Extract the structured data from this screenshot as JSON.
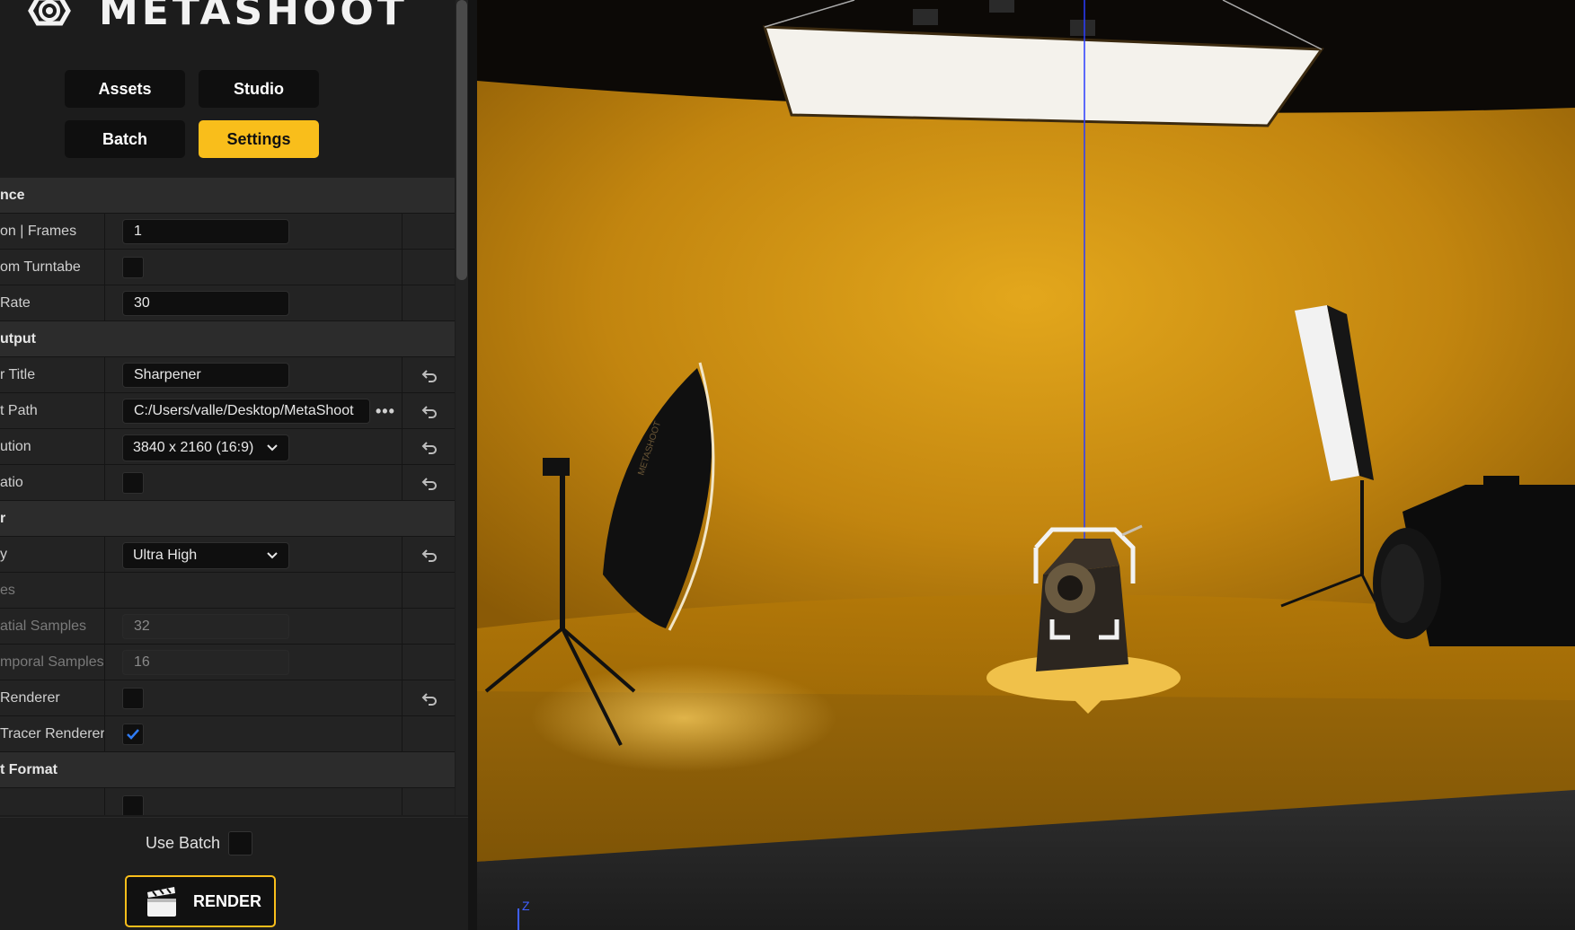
{
  "app": {
    "brand": "METASHOOT"
  },
  "nav": {
    "assets": "Assets",
    "studio": "Studio",
    "batch": "Batch",
    "settings": "Settings"
  },
  "settings": {
    "sequence_header": "nce",
    "duration_label": "on | Frames",
    "duration_value": "1",
    "custom_turntable_label": "om Turntabe",
    "frame_rate_label": " Rate",
    "frame_rate_value": "30",
    "output_header": "utput",
    "render_title_label": "r Title",
    "render_title_value": "Sharpener",
    "output_path_label": "t Path",
    "output_path_value": "C:/Users/valle/Desktop/MetaShoot",
    "browse_label": "•••",
    "resolution_label": "ution",
    "resolution_value": "3840 x 2160 (16:9)",
    "ratio_label": "atio",
    "renderer_header": "r",
    "quality_label": "y",
    "quality_value": "Ultra High",
    "samples_label": "es",
    "spatial_label": "atial Samples",
    "spatial_value": "32",
    "temporal_label": "mporal Samples",
    "temporal_value": "16",
    "path_renderer_label": "Renderer",
    "path_tracer_label": "Tracer Renderer",
    "format_header": "t Format"
  },
  "bottom": {
    "use_batch_label": "Use Batch",
    "render_label": "RENDER"
  },
  "viewport": {
    "axis_z": "Z",
    "softbox_text": "METASHOOT"
  },
  "colors": {
    "accent": "#f9be1b",
    "studio_wall": "#c88a12",
    "panel_bg": "#1c1c1c",
    "check_blue": "#2f7cf6"
  }
}
